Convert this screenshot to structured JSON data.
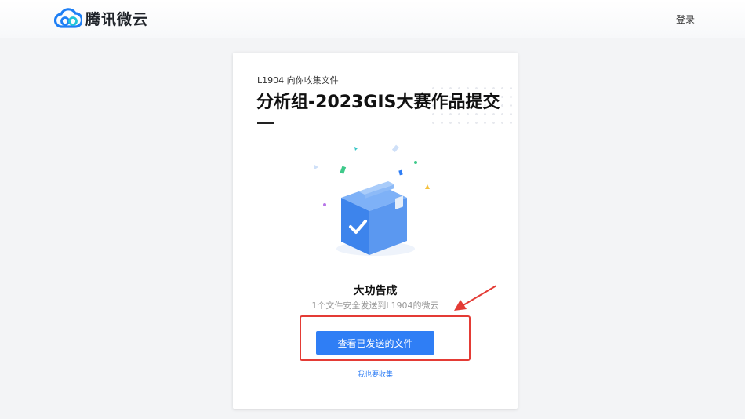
{
  "header": {
    "logo_text": "腾讯微云",
    "logo_icon": "cloud-logo-icon",
    "login_label": "登录"
  },
  "card": {
    "subtitle": "L1904 向你收集文件",
    "title": "分析组-2023GIS大赛作品提交",
    "illustration": "package-check-icon",
    "success_text": "大功告成",
    "description": "1个文件安全发送到L1904的微云",
    "view_button_label": "查看已发送的文件",
    "collect_link_label": "我也要收集"
  },
  "annotation": {
    "color": "#e43b35"
  },
  "colors": {
    "accent": "#2f7ef5",
    "background": "#f3f4f6"
  }
}
